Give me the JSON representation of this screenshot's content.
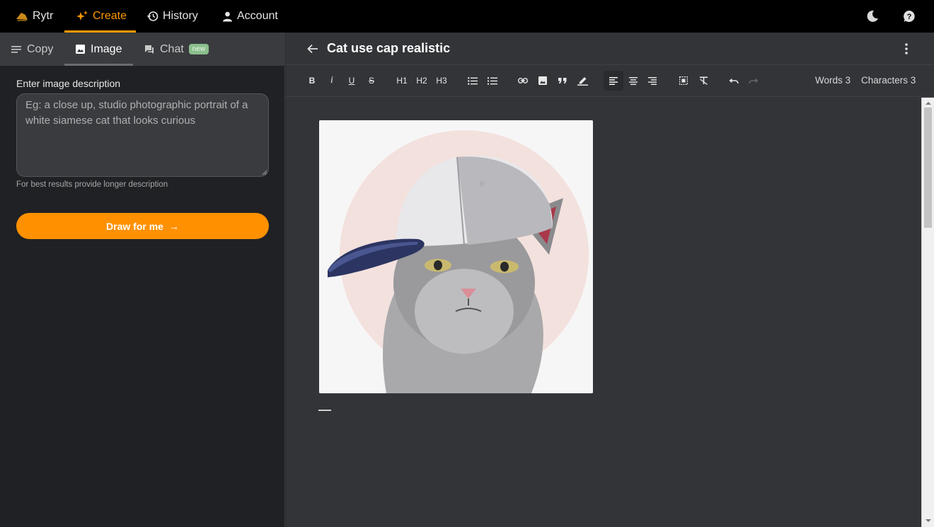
{
  "nav": {
    "brand": "Rytr",
    "create": "Create",
    "history": "History",
    "account": "Account",
    "accent_color": "#ff9800"
  },
  "sidebar": {
    "tabs": [
      {
        "label": "Copy",
        "icon": "lines-icon"
      },
      {
        "label": "Image",
        "icon": "image-icon",
        "active": true
      },
      {
        "label": "Chat",
        "icon": "chat-icon",
        "badge": "new"
      }
    ],
    "field_label": "Enter image description",
    "placeholder": "Eg: a close up, studio photographic portrait of a white siamese cat that looks curious",
    "hint": "For best results provide longer description",
    "draw_button": "Draw for me",
    "draw_button_color": "#ff9100"
  },
  "editor": {
    "title": "Cat use cap realistic",
    "toolbar": {
      "bold": "B",
      "italic": "i",
      "underline": "U",
      "strike": "S",
      "h1": "H1",
      "h2": "H2",
      "h3": "H3"
    },
    "counters": {
      "words": "Words 3",
      "characters": "Characters 3"
    }
  }
}
